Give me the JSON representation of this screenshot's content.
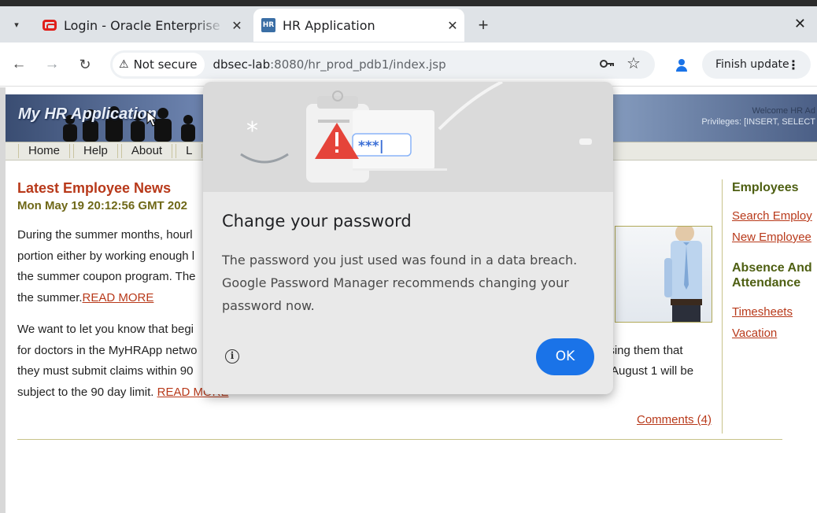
{
  "browser": {
    "tabs": [
      {
        "title": "Login - Oracle Enterprise",
        "favicon": "oracle-icon",
        "active": false
      },
      {
        "title": "HR Application",
        "favicon": "hr-icon",
        "active": true
      }
    ],
    "favicon_hr_text": "HR",
    "security_label": "Not secure",
    "url_host": "dbsec-lab",
    "url_rest": ":8080/hr_prod_pdb1/index.jsp",
    "finish_update": "Finish update"
  },
  "site": {
    "brand": "My HR Application",
    "welcome": "Welcome HR Ad",
    "privileges": "Privileges: [INSERT, SELECT",
    "menu": [
      "Home",
      "Help",
      "About",
      "L"
    ]
  },
  "news": {
    "heading": "Latest Employee News",
    "date": "Mon May 19 20:12:56 GMT 202",
    "para1": {
      "lines": [
        "During the summer months, hourl",
        "portion either by working enough l",
        "the summer coupon program. The"
      ],
      "last_prefix": "the summer.",
      "link": "READ MORE"
    },
    "para2": {
      "lines": [
        {
          "left": "We want to let you know that begi",
          "right": ""
        },
        {
          "left": "for doctors in the MyHRApp netwo",
          "right": "ising them that"
        },
        {
          "left": "they must submit claims within 90",
          "right": "August 1 will be"
        }
      ],
      "last_prefix": "subject to the 90 day limit.",
      "link": "READ MORE"
    },
    "comments": "Comments (4)"
  },
  "sidebar": {
    "employees_heading": "Employees",
    "employees_links": [
      "Search Employ",
      "New Employee"
    ],
    "absence_heading_line1": "Absence And",
    "absence_heading_line2": "Attendance",
    "absence_links": [
      "Timesheets",
      "Vacation"
    ]
  },
  "dialog": {
    "title": "Change your password",
    "body": "The password you just used was found in a data breach. Google Password Manager recommends changing your password now.",
    "illustration_text": "***|",
    "ok_label": "OK"
  },
  "colors": {
    "accent_blue": "#1a73e8",
    "link_red": "#b8391a",
    "heading_olive": "#4e5f12"
  }
}
